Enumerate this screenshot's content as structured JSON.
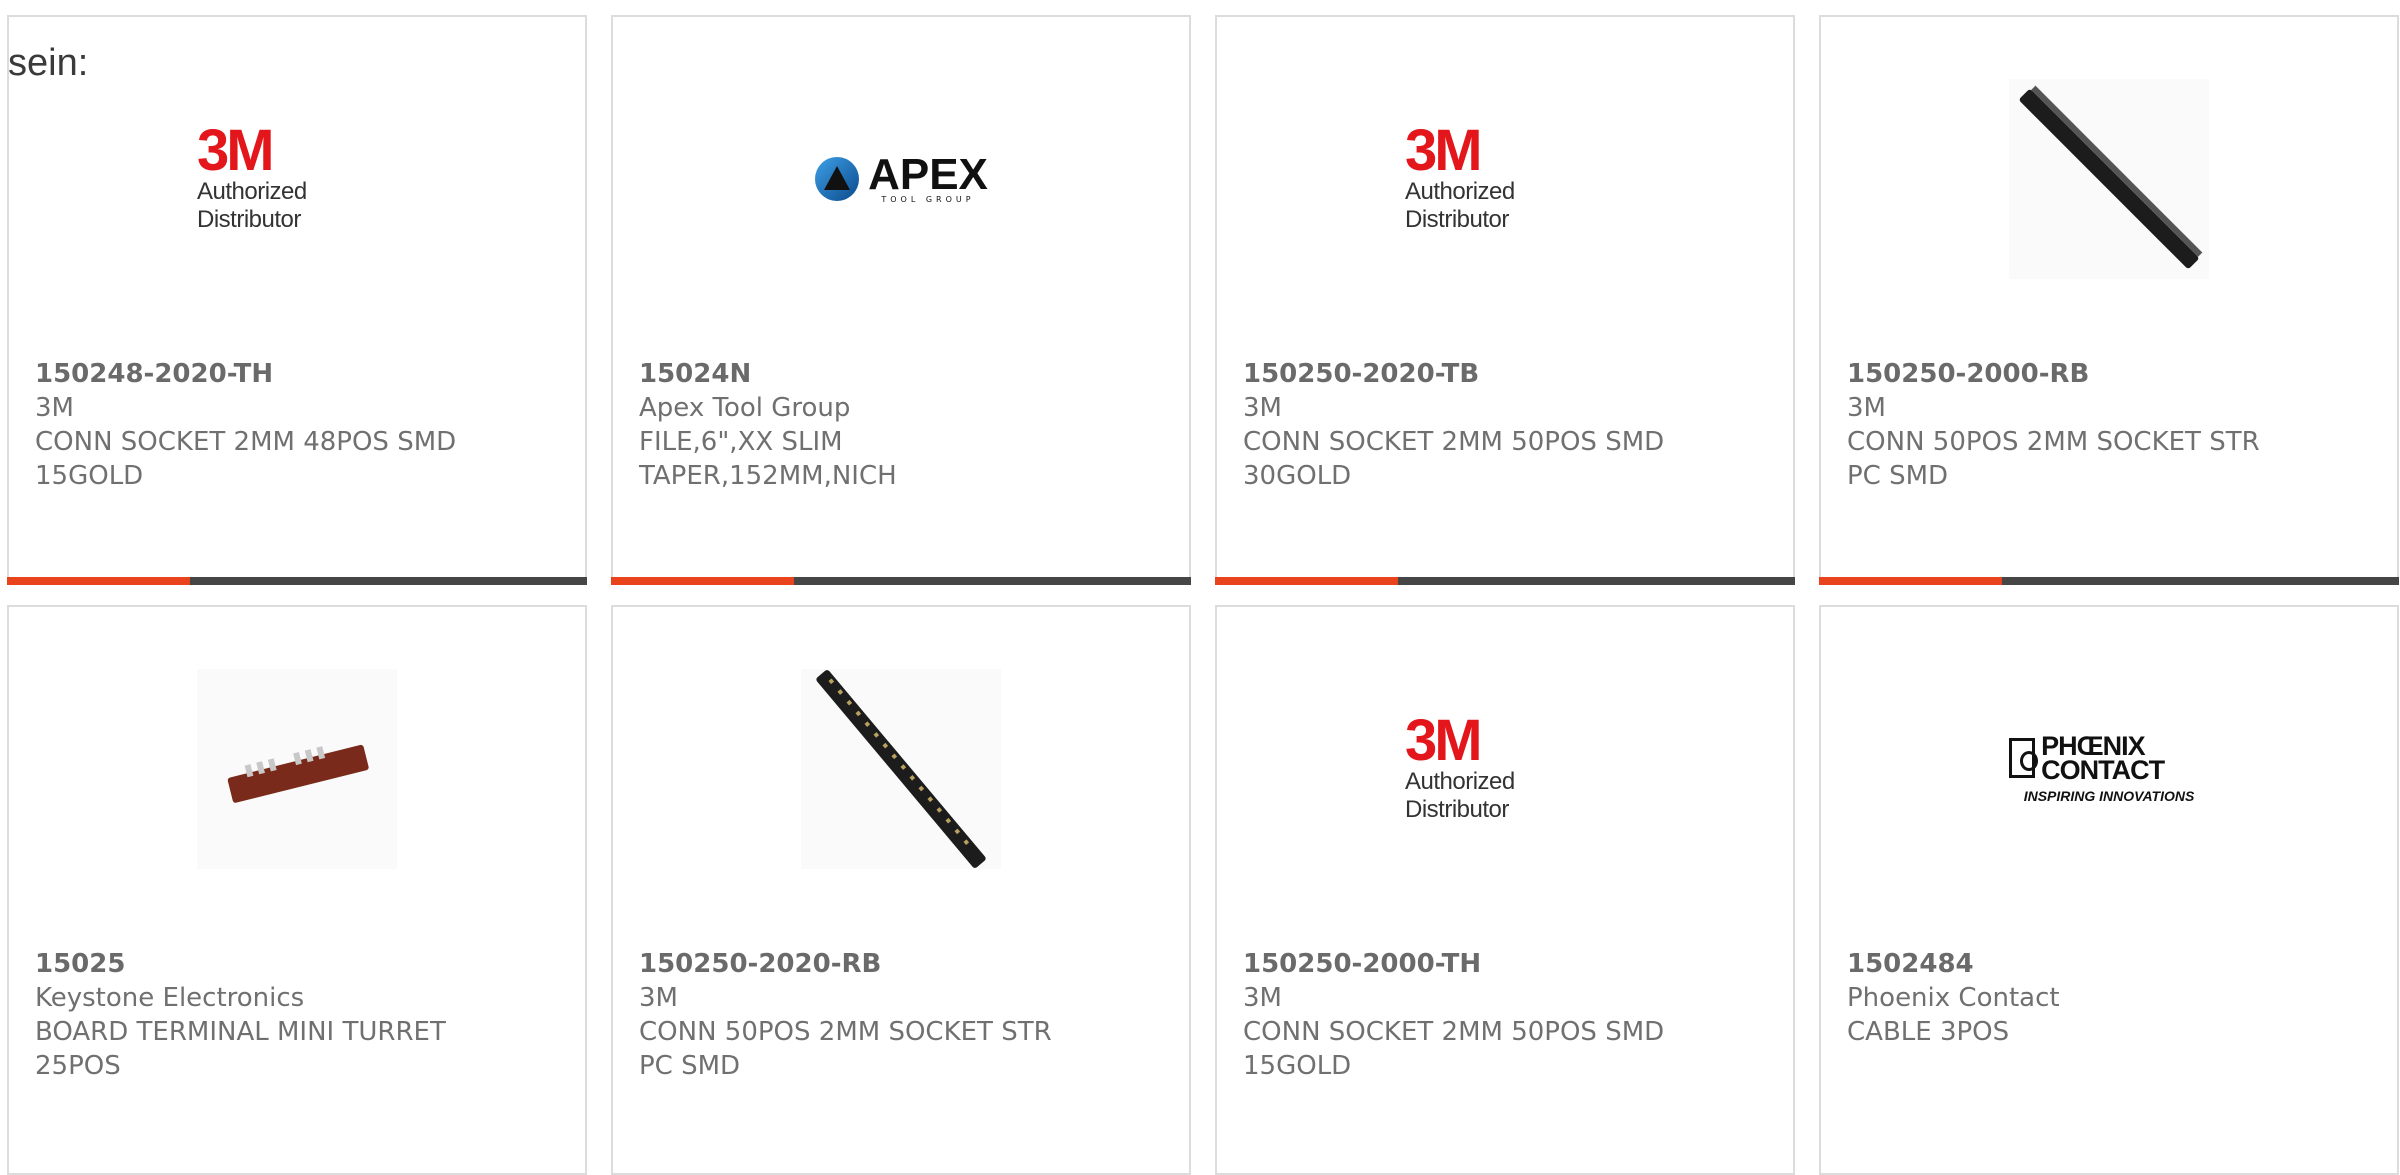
{
  "intro_text": "sein:",
  "colors": {
    "accent": "#e8431c",
    "bar": "#464646",
    "text": "#707070"
  },
  "products": [
    {
      "part_number": "150248-2020-TH",
      "manufacturer": "3M",
      "description": "CONN SOCKET 2MM 48POS SMD 15GOLD",
      "image": "3m-logo",
      "logo_mark": "3M",
      "logo_text": "Authorized Distributor"
    },
    {
      "part_number": "15024N",
      "manufacturer": "Apex Tool Group",
      "description": "FILE,6\",XX SLIM TAPER,152MM,NICH",
      "image": "apex-logo",
      "logo_mark": "APEX",
      "logo_text": "TOOL GROUP"
    },
    {
      "part_number": "150250-2020-TB",
      "manufacturer": "3M",
      "description": "CONN SOCKET 2MM 50POS SMD 30GOLD",
      "image": "3m-logo",
      "logo_mark": "3M",
      "logo_text": "Authorized Distributor"
    },
    {
      "part_number": "150250-2000-RB",
      "manufacturer": "3M",
      "description": "CONN 50POS 2MM SOCKET STR PC SMD",
      "image": "connector-strip-photo"
    },
    {
      "part_number": "15025",
      "manufacturer": "Keystone Electronics",
      "description": "BOARD TERMINAL MINI TURRET 25POS",
      "image": "turret-board-photo"
    },
    {
      "part_number": "150250-2020-RB",
      "manufacturer": "3M",
      "description": "CONN 50POS 2MM SOCKET STR PC SMD",
      "image": "connector-strip-photo"
    },
    {
      "part_number": "150250-2000-TH",
      "manufacturer": "3M",
      "description": "CONN SOCKET 2MM 50POS SMD 15GOLD",
      "image": "3m-logo",
      "logo_mark": "3M",
      "logo_text": "Authorized Distributor"
    },
    {
      "part_number": "1502484",
      "manufacturer": "Phoenix Contact",
      "description": "CABLE 3POS",
      "image": "phoenix-logo",
      "logo_mark": "PHŒNIX CONTACT",
      "logo_text": "INSPIRING INNOVATIONS"
    }
  ]
}
